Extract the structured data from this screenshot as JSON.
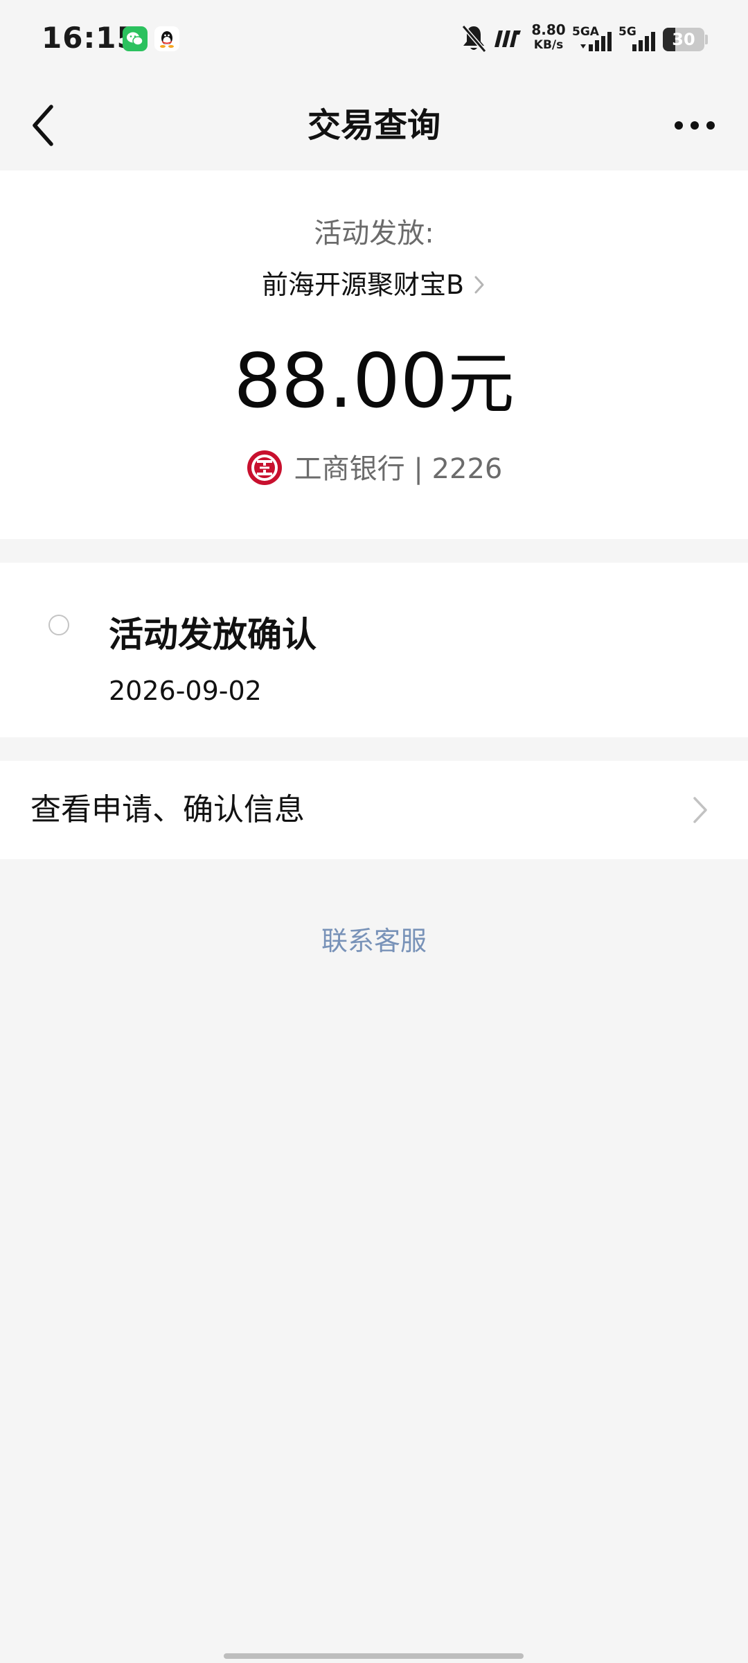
{
  "status_bar": {
    "time": "16:15",
    "net_speed": "8.80",
    "net_speed_unit": "KB/s",
    "network_1": "5GA",
    "network_2": "5G",
    "battery": "30",
    "battery_level_percent": 30,
    "icons": [
      "wechat-icon",
      "qq-icon",
      "bell-off-icon",
      "hd-icon",
      "signal-icon",
      "signal-icon",
      "battery-icon"
    ]
  },
  "nav": {
    "title": "交易查询",
    "back_icon": "chevron-left-icon",
    "more_icon": "more-dots-icon"
  },
  "summary": {
    "label": "活动发放:",
    "product": "前海开源聚财宝B",
    "amount": "88.00",
    "amount_unit": "元",
    "bank": "工商银行 | 2226"
  },
  "timeline": {
    "title": "活动发放确认",
    "date": "2026-09-02"
  },
  "detail": {
    "label": "查看申请、确认信息"
  },
  "support": {
    "label": "联系客服"
  },
  "colors": {
    "page_bg": "#f5f5f5",
    "card_bg": "#ffffff",
    "link": "#7892b8",
    "bank_red": "#c8102e",
    "wechat_green": "#2bc15e"
  }
}
